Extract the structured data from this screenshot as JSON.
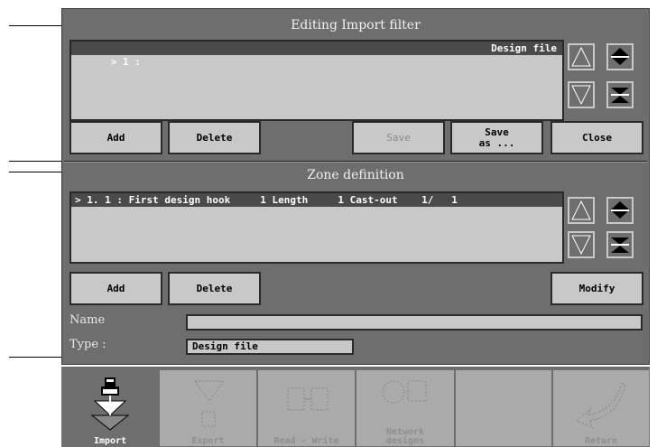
{
  "import_filter": {
    "title": "Editing Import filter",
    "row_prefix": "> 1 :",
    "row_type": "Design file",
    "buttons": {
      "add": "Add",
      "delete": "Delete",
      "save": "Save",
      "save_as": "Save\nas ...",
      "close": "Close"
    }
  },
  "zone": {
    "title": "Zone definition",
    "row": "> 1. 1 : First design hook     1 Length     1 Cast-out    1/   1",
    "buttons": {
      "add": "Add",
      "delete": "Delete",
      "modify": "Modify"
    },
    "name_label": "Name",
    "name_value": "",
    "type_label": "Type :",
    "type_value": "Design file"
  },
  "toolbar": {
    "import": "Import",
    "export": "Export",
    "read_write": "Read - Write",
    "network": "Network\ndesigns",
    "empty": "",
    "return": "Return"
  },
  "colors": {
    "panel": "#6e6e6e",
    "control": "#c8c8c8",
    "selected_row": "#4a4a4a"
  }
}
